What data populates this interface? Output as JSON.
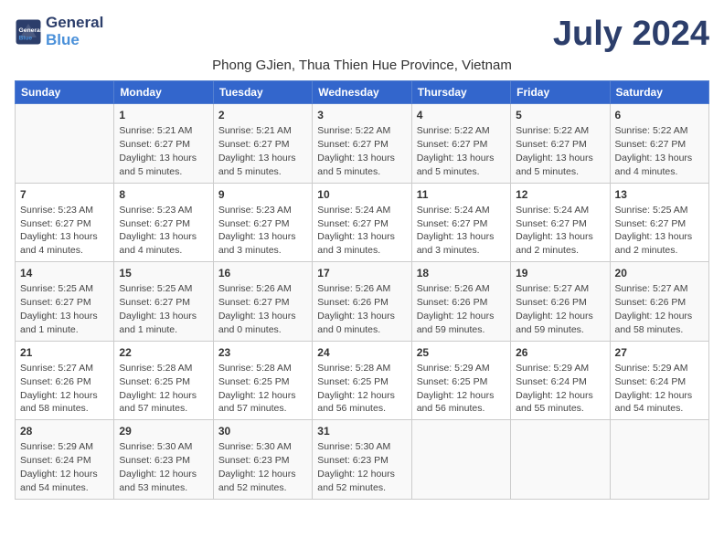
{
  "header": {
    "logo_line1": "General",
    "logo_line2": "Blue",
    "month_title": "July 2024",
    "subtitle": "Phong GJien, Thua Thien Hue Province, Vietnam"
  },
  "days_of_week": [
    "Sunday",
    "Monday",
    "Tuesday",
    "Wednesday",
    "Thursday",
    "Friday",
    "Saturday"
  ],
  "weeks": [
    [
      {
        "day": "",
        "info": ""
      },
      {
        "day": "1",
        "info": "Sunrise: 5:21 AM\nSunset: 6:27 PM\nDaylight: 13 hours\nand 5 minutes."
      },
      {
        "day": "2",
        "info": "Sunrise: 5:21 AM\nSunset: 6:27 PM\nDaylight: 13 hours\nand 5 minutes."
      },
      {
        "day": "3",
        "info": "Sunrise: 5:22 AM\nSunset: 6:27 PM\nDaylight: 13 hours\nand 5 minutes."
      },
      {
        "day": "4",
        "info": "Sunrise: 5:22 AM\nSunset: 6:27 PM\nDaylight: 13 hours\nand 5 minutes."
      },
      {
        "day": "5",
        "info": "Sunrise: 5:22 AM\nSunset: 6:27 PM\nDaylight: 13 hours\nand 5 minutes."
      },
      {
        "day": "6",
        "info": "Sunrise: 5:22 AM\nSunset: 6:27 PM\nDaylight: 13 hours\nand 4 minutes."
      }
    ],
    [
      {
        "day": "7",
        "info": "Sunrise: 5:23 AM\nSunset: 6:27 PM\nDaylight: 13 hours\nand 4 minutes."
      },
      {
        "day": "8",
        "info": "Sunrise: 5:23 AM\nSunset: 6:27 PM\nDaylight: 13 hours\nand 4 minutes."
      },
      {
        "day": "9",
        "info": "Sunrise: 5:23 AM\nSunset: 6:27 PM\nDaylight: 13 hours\nand 3 minutes."
      },
      {
        "day": "10",
        "info": "Sunrise: 5:24 AM\nSunset: 6:27 PM\nDaylight: 13 hours\nand 3 minutes."
      },
      {
        "day": "11",
        "info": "Sunrise: 5:24 AM\nSunset: 6:27 PM\nDaylight: 13 hours\nand 3 minutes."
      },
      {
        "day": "12",
        "info": "Sunrise: 5:24 AM\nSunset: 6:27 PM\nDaylight: 13 hours\nand 2 minutes."
      },
      {
        "day": "13",
        "info": "Sunrise: 5:25 AM\nSunset: 6:27 PM\nDaylight: 13 hours\nand 2 minutes."
      }
    ],
    [
      {
        "day": "14",
        "info": "Sunrise: 5:25 AM\nSunset: 6:27 PM\nDaylight: 13 hours\nand 1 minute."
      },
      {
        "day": "15",
        "info": "Sunrise: 5:25 AM\nSunset: 6:27 PM\nDaylight: 13 hours\nand 1 minute."
      },
      {
        "day": "16",
        "info": "Sunrise: 5:26 AM\nSunset: 6:27 PM\nDaylight: 13 hours\nand 0 minutes."
      },
      {
        "day": "17",
        "info": "Sunrise: 5:26 AM\nSunset: 6:26 PM\nDaylight: 13 hours\nand 0 minutes."
      },
      {
        "day": "18",
        "info": "Sunrise: 5:26 AM\nSunset: 6:26 PM\nDaylight: 12 hours\nand 59 minutes."
      },
      {
        "day": "19",
        "info": "Sunrise: 5:27 AM\nSunset: 6:26 PM\nDaylight: 12 hours\nand 59 minutes."
      },
      {
        "day": "20",
        "info": "Sunrise: 5:27 AM\nSunset: 6:26 PM\nDaylight: 12 hours\nand 58 minutes."
      }
    ],
    [
      {
        "day": "21",
        "info": "Sunrise: 5:27 AM\nSunset: 6:26 PM\nDaylight: 12 hours\nand 58 minutes."
      },
      {
        "day": "22",
        "info": "Sunrise: 5:28 AM\nSunset: 6:25 PM\nDaylight: 12 hours\nand 57 minutes."
      },
      {
        "day": "23",
        "info": "Sunrise: 5:28 AM\nSunset: 6:25 PM\nDaylight: 12 hours\nand 57 minutes."
      },
      {
        "day": "24",
        "info": "Sunrise: 5:28 AM\nSunset: 6:25 PM\nDaylight: 12 hours\nand 56 minutes."
      },
      {
        "day": "25",
        "info": "Sunrise: 5:29 AM\nSunset: 6:25 PM\nDaylight: 12 hours\nand 56 minutes."
      },
      {
        "day": "26",
        "info": "Sunrise: 5:29 AM\nSunset: 6:24 PM\nDaylight: 12 hours\nand 55 minutes."
      },
      {
        "day": "27",
        "info": "Sunrise: 5:29 AM\nSunset: 6:24 PM\nDaylight: 12 hours\nand 54 minutes."
      }
    ],
    [
      {
        "day": "28",
        "info": "Sunrise: 5:29 AM\nSunset: 6:24 PM\nDaylight: 12 hours\nand 54 minutes."
      },
      {
        "day": "29",
        "info": "Sunrise: 5:30 AM\nSunset: 6:23 PM\nDaylight: 12 hours\nand 53 minutes."
      },
      {
        "day": "30",
        "info": "Sunrise: 5:30 AM\nSunset: 6:23 PM\nDaylight: 12 hours\nand 52 minutes."
      },
      {
        "day": "31",
        "info": "Sunrise: 5:30 AM\nSunset: 6:23 PM\nDaylight: 12 hours\nand 52 minutes."
      },
      {
        "day": "",
        "info": ""
      },
      {
        "day": "",
        "info": ""
      },
      {
        "day": "",
        "info": ""
      }
    ]
  ]
}
